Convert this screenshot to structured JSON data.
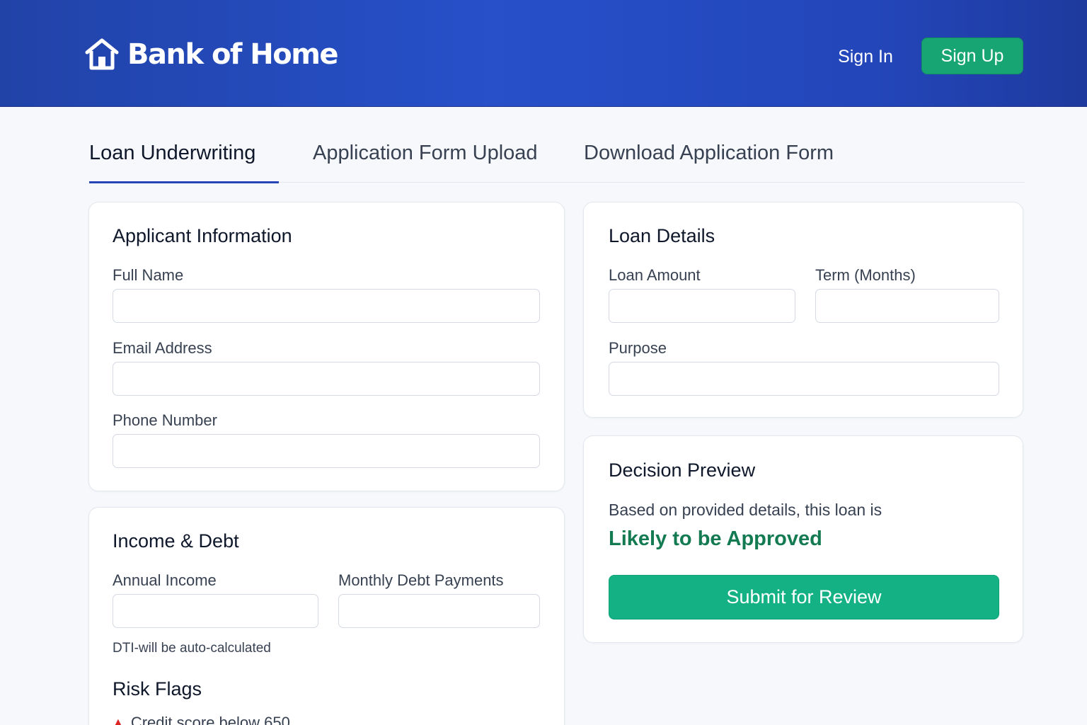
{
  "header": {
    "brand_name": "Bank of Home",
    "brand_icon": "house-icon",
    "sign_in_label": "Sign In",
    "sign_up_label": "Sign Up"
  },
  "tabs": [
    {
      "label": "Loan Underwriting",
      "active": true
    },
    {
      "label": "Application Form Upload",
      "active": false
    },
    {
      "label": "Download Application Form",
      "active": false
    }
  ],
  "applicant": {
    "title": "Applicant Information",
    "full_name": {
      "label": "Full Name",
      "value": ""
    },
    "email": {
      "label": "Email Address",
      "value": ""
    },
    "phone": {
      "label": "Phone Number",
      "value": ""
    }
  },
  "income_debt": {
    "title": "Income & Debt",
    "annual_income": {
      "label": "Annual Income",
      "value": ""
    },
    "monthly_debt": {
      "label": "Monthly Debt Payments",
      "value": ""
    },
    "dti_hint": "DTI-will be auto-calculated",
    "risk_title": "Risk Flags",
    "risk_flags": [
      "Credit score below 650"
    ]
  },
  "loan_details": {
    "title": "Loan Details",
    "loan_amount": {
      "label": "Loan Amount",
      "value": ""
    },
    "term": {
      "label": "Term (Months)",
      "value": ""
    },
    "purpose": {
      "label": "Purpose",
      "value": ""
    }
  },
  "decision": {
    "title": "Decision Preview",
    "text": "Based on provided details, this loan is",
    "status": "Likely to be Approved",
    "submit_label": "Submit for Review"
  },
  "colors": {
    "header_blue": "#2750c9",
    "accent_green": "#17a573",
    "status_green": "#137a52",
    "risk_red": "#dc2626"
  }
}
